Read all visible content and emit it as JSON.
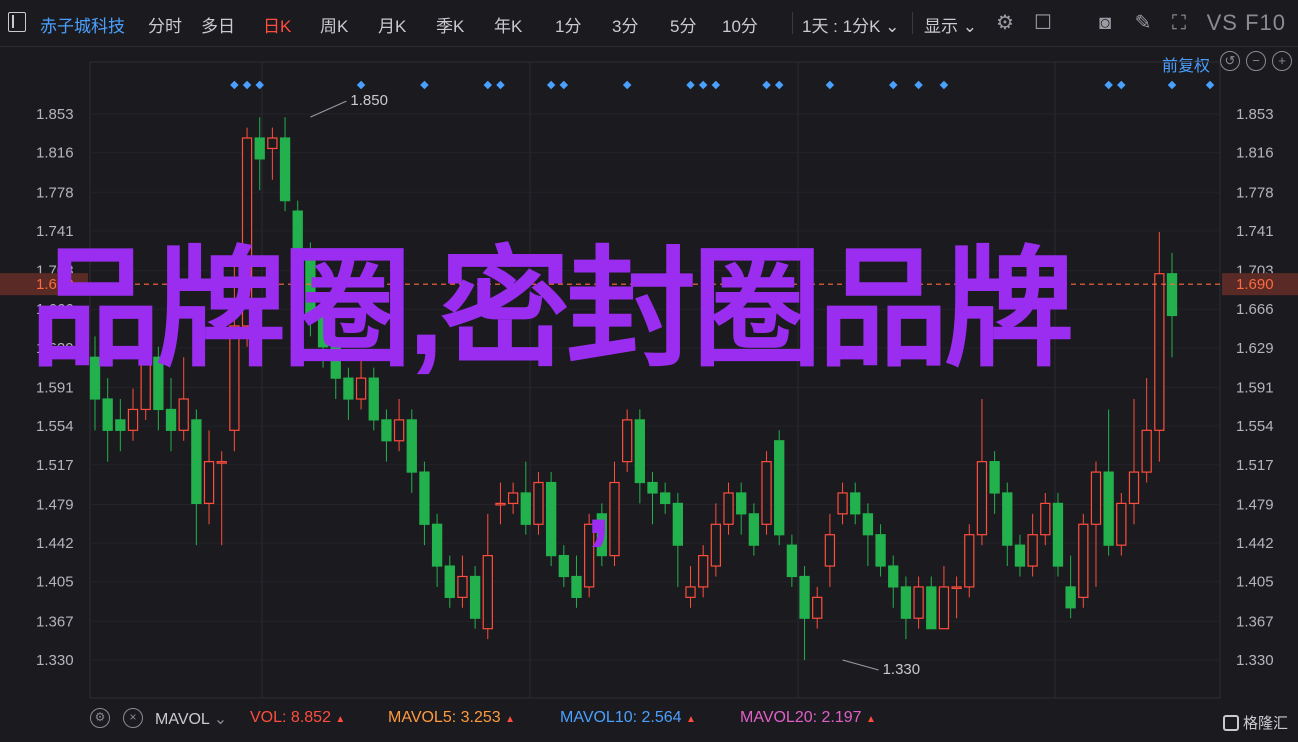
{
  "toolbar": {
    "stock_name": "赤子城科技",
    "periods": [
      "分时",
      "多日",
      "日K",
      "周K",
      "月K",
      "季K",
      "年K",
      "1分",
      "3分",
      "5分",
      "10分"
    ],
    "active_period": "日K",
    "range_select": "1天 : 1分K",
    "display_select": "显示",
    "compare": "VS F10"
  },
  "price_adjust": "前复权",
  "price_levels": [
    "1.853",
    "1.816",
    "1.778",
    "1.741",
    "1.703",
    "1.666",
    "1.629",
    "1.591",
    "1.554",
    "1.517",
    "1.479",
    "1.442",
    "1.405",
    "1.367",
    "1.330"
  ],
  "current_price": "1.690",
  "watermark": {
    "line": "品牌圈,密封圈品牌",
    "extra": ","
  },
  "colors": {
    "up": "#ff4d3d",
    "down": "#22b14c",
    "accent": "#4aa0ff",
    "watermark": "#9b2df0",
    "price_line": "#ff6a3d"
  },
  "chart_data": {
    "type": "candlestick",
    "ylim": [
      1.31,
      1.87
    ],
    "y_ticks": [
      1.853,
      1.816,
      1.778,
      1.741,
      1.703,
      1.666,
      1.629,
      1.591,
      1.554,
      1.517,
      1.479,
      1.442,
      1.405,
      1.367,
      1.33
    ],
    "current_price": 1.69,
    "annotations": [
      {
        "label": "1.850",
        "value": 1.85,
        "bar": 17
      },
      {
        "label": "1.330",
        "value": 1.33,
        "bar": 59
      }
    ],
    "event_marker_bars": [
      11,
      12,
      13,
      21,
      26,
      31,
      32,
      36,
      37,
      42,
      47,
      48,
      49,
      53,
      54,
      58,
      63,
      65,
      67,
      80,
      81,
      85,
      88
    ],
    "candles": [
      {
        "o": 1.62,
        "c": 1.58,
        "h": 1.64,
        "l": 1.55
      },
      {
        "o": 1.58,
        "c": 1.55,
        "h": 1.6,
        "l": 1.52
      },
      {
        "o": 1.56,
        "c": 1.55,
        "h": 1.58,
        "l": 1.53
      },
      {
        "o": 1.55,
        "c": 1.57,
        "h": 1.59,
        "l": 1.54
      },
      {
        "o": 1.57,
        "c": 1.62,
        "h": 1.65,
        "l": 1.56
      },
      {
        "o": 1.62,
        "c": 1.57,
        "h": 1.63,
        "l": 1.55
      },
      {
        "o": 1.57,
        "c": 1.55,
        "h": 1.6,
        "l": 1.53
      },
      {
        "o": 1.55,
        "c": 1.58,
        "h": 1.62,
        "l": 1.54
      },
      {
        "o": 1.56,
        "c": 1.48,
        "h": 1.57,
        "l": 1.44
      },
      {
        "o": 1.48,
        "c": 1.52,
        "h": 1.55,
        "l": 1.46
      },
      {
        "o": 1.52,
        "c": 1.52,
        "h": 1.53,
        "l": 1.44
      },
      {
        "o": 1.55,
        "c": 1.65,
        "h": 1.72,
        "l": 1.53
      },
      {
        "o": 1.65,
        "c": 1.83,
        "h": 1.84,
        "l": 1.63
      },
      {
        "o": 1.83,
        "c": 1.81,
        "h": 1.85,
        "l": 1.78
      },
      {
        "o": 1.82,
        "c": 1.83,
        "h": 1.84,
        "l": 1.79
      },
      {
        "o": 1.83,
        "c": 1.77,
        "h": 1.85,
        "l": 1.76
      },
      {
        "o": 1.76,
        "c": 1.72,
        "h": 1.77,
        "l": 1.7
      },
      {
        "o": 1.72,
        "c": 1.66,
        "h": 1.73,
        "l": 1.64
      },
      {
        "o": 1.66,
        "c": 1.63,
        "h": 1.68,
        "l": 1.61
      },
      {
        "o": 1.63,
        "c": 1.6,
        "h": 1.64,
        "l": 1.58
      },
      {
        "o": 1.6,
        "c": 1.58,
        "h": 1.61,
        "l": 1.56
      },
      {
        "o": 1.58,
        "c": 1.6,
        "h": 1.62,
        "l": 1.57
      },
      {
        "o": 1.6,
        "c": 1.56,
        "h": 1.61,
        "l": 1.55
      },
      {
        "o": 1.56,
        "c": 1.54,
        "h": 1.57,
        "l": 1.52
      },
      {
        "o": 1.54,
        "c": 1.56,
        "h": 1.58,
        "l": 1.53
      },
      {
        "o": 1.56,
        "c": 1.51,
        "h": 1.57,
        "l": 1.49
      },
      {
        "o": 1.51,
        "c": 1.46,
        "h": 1.52,
        "l": 1.44
      },
      {
        "o": 1.46,
        "c": 1.42,
        "h": 1.47,
        "l": 1.4
      },
      {
        "o": 1.42,
        "c": 1.39,
        "h": 1.43,
        "l": 1.38
      },
      {
        "o": 1.39,
        "c": 1.41,
        "h": 1.43,
        "l": 1.38
      },
      {
        "o": 1.41,
        "c": 1.37,
        "h": 1.42,
        "l": 1.36
      },
      {
        "o": 1.36,
        "c": 1.43,
        "h": 1.47,
        "l": 1.35
      },
      {
        "o": 1.48,
        "c": 1.48,
        "h": 1.5,
        "l": 1.46
      },
      {
        "o": 1.48,
        "c": 1.49,
        "h": 1.5,
        "l": 1.47
      },
      {
        "o": 1.49,
        "c": 1.46,
        "h": 1.52,
        "l": 1.45
      },
      {
        "o": 1.46,
        "c": 1.5,
        "h": 1.51,
        "l": 1.45
      },
      {
        "o": 1.5,
        "c": 1.43,
        "h": 1.51,
        "l": 1.42
      },
      {
        "o": 1.43,
        "c": 1.41,
        "h": 1.44,
        "l": 1.4
      },
      {
        "o": 1.41,
        "c": 1.39,
        "h": 1.43,
        "l": 1.38
      },
      {
        "o": 1.4,
        "c": 1.46,
        "h": 1.47,
        "l": 1.39
      },
      {
        "o": 1.47,
        "c": 1.43,
        "h": 1.48,
        "l": 1.42
      },
      {
        "o": 1.43,
        "c": 1.5,
        "h": 1.52,
        "l": 1.42
      },
      {
        "o": 1.52,
        "c": 1.56,
        "h": 1.57,
        "l": 1.51
      },
      {
        "o": 1.56,
        "c": 1.5,
        "h": 1.57,
        "l": 1.48
      },
      {
        "o": 1.5,
        "c": 1.49,
        "h": 1.51,
        "l": 1.46
      },
      {
        "o": 1.49,
        "c": 1.48,
        "h": 1.5,
        "l": 1.47
      },
      {
        "o": 1.48,
        "c": 1.44,
        "h": 1.49,
        "l": 1.4
      },
      {
        "o": 1.39,
        "c": 1.4,
        "h": 1.42,
        "l": 1.38
      },
      {
        "o": 1.4,
        "c": 1.43,
        "h": 1.44,
        "l": 1.39
      },
      {
        "o": 1.42,
        "c": 1.46,
        "h": 1.48,
        "l": 1.41
      },
      {
        "o": 1.46,
        "c": 1.49,
        "h": 1.5,
        "l": 1.45
      },
      {
        "o": 1.49,
        "c": 1.47,
        "h": 1.5,
        "l": 1.45
      },
      {
        "o": 1.47,
        "c": 1.44,
        "h": 1.48,
        "l": 1.43
      },
      {
        "o": 1.46,
        "c": 1.52,
        "h": 1.53,
        "l": 1.45
      },
      {
        "o": 1.54,
        "c": 1.45,
        "h": 1.55,
        "l": 1.44
      },
      {
        "o": 1.44,
        "c": 1.41,
        "h": 1.45,
        "l": 1.4
      },
      {
        "o": 1.41,
        "c": 1.37,
        "h": 1.42,
        "l": 1.33
      },
      {
        "o": 1.37,
        "c": 1.39,
        "h": 1.4,
        "l": 1.36
      },
      {
        "o": 1.42,
        "c": 1.45,
        "h": 1.47,
        "l": 1.4
      },
      {
        "o": 1.47,
        "c": 1.49,
        "h": 1.5,
        "l": 1.46
      },
      {
        "o": 1.49,
        "c": 1.47,
        "h": 1.5,
        "l": 1.46
      },
      {
        "o": 1.47,
        "c": 1.45,
        "h": 1.48,
        "l": 1.42
      },
      {
        "o": 1.45,
        "c": 1.42,
        "h": 1.46,
        "l": 1.41
      },
      {
        "o": 1.42,
        "c": 1.4,
        "h": 1.43,
        "l": 1.38
      },
      {
        "o": 1.4,
        "c": 1.37,
        "h": 1.41,
        "l": 1.35
      },
      {
        "o": 1.37,
        "c": 1.4,
        "h": 1.41,
        "l": 1.36
      },
      {
        "o": 1.4,
        "c": 1.36,
        "h": 1.41,
        "l": 1.36
      },
      {
        "o": 1.36,
        "c": 1.4,
        "h": 1.42,
        "l": 1.36
      },
      {
        "o": 1.4,
        "c": 1.4,
        "h": 1.41,
        "l": 1.37
      },
      {
        "o": 1.4,
        "c": 1.45,
        "h": 1.46,
        "l": 1.39
      },
      {
        "o": 1.45,
        "c": 1.52,
        "h": 1.58,
        "l": 1.44
      },
      {
        "o": 1.52,
        "c": 1.49,
        "h": 1.53,
        "l": 1.47
      },
      {
        "o": 1.49,
        "c": 1.44,
        "h": 1.5,
        "l": 1.42
      },
      {
        "o": 1.44,
        "c": 1.42,
        "h": 1.45,
        "l": 1.41
      },
      {
        "o": 1.42,
        "c": 1.45,
        "h": 1.47,
        "l": 1.41
      },
      {
        "o": 1.45,
        "c": 1.48,
        "h": 1.49,
        "l": 1.44
      },
      {
        "o": 1.48,
        "c": 1.42,
        "h": 1.49,
        "l": 1.41
      },
      {
        "o": 1.4,
        "c": 1.38,
        "h": 1.43,
        "l": 1.37
      },
      {
        "o": 1.39,
        "c": 1.46,
        "h": 1.47,
        "l": 1.38
      },
      {
        "o": 1.46,
        "c": 1.51,
        "h": 1.52,
        "l": 1.4
      },
      {
        "o": 1.51,
        "c": 1.44,
        "h": 1.57,
        "l": 1.43
      },
      {
        "o": 1.44,
        "c": 1.48,
        "h": 1.49,
        "l": 1.43
      },
      {
        "o": 1.48,
        "c": 1.51,
        "h": 1.58,
        "l": 1.46
      },
      {
        "o": 1.51,
        "c": 1.55,
        "h": 1.6,
        "l": 1.5
      },
      {
        "o": 1.55,
        "c": 1.7,
        "h": 1.74,
        "l": 1.52
      },
      {
        "o": 1.7,
        "c": 1.66,
        "h": 1.72,
        "l": 1.62
      }
    ]
  },
  "footer": {
    "indicator": "MAVOL",
    "vol_label": "VOL:",
    "vol_value": "8.852",
    "mavol5_label": "MAVOL5:",
    "mavol5_value": "3.253",
    "mavol10_label": "MAVOL10:",
    "mavol10_value": "2.564",
    "mavol20_label": "MAVOL20:",
    "mavol20_value": "2.197",
    "logo": "格隆汇"
  }
}
